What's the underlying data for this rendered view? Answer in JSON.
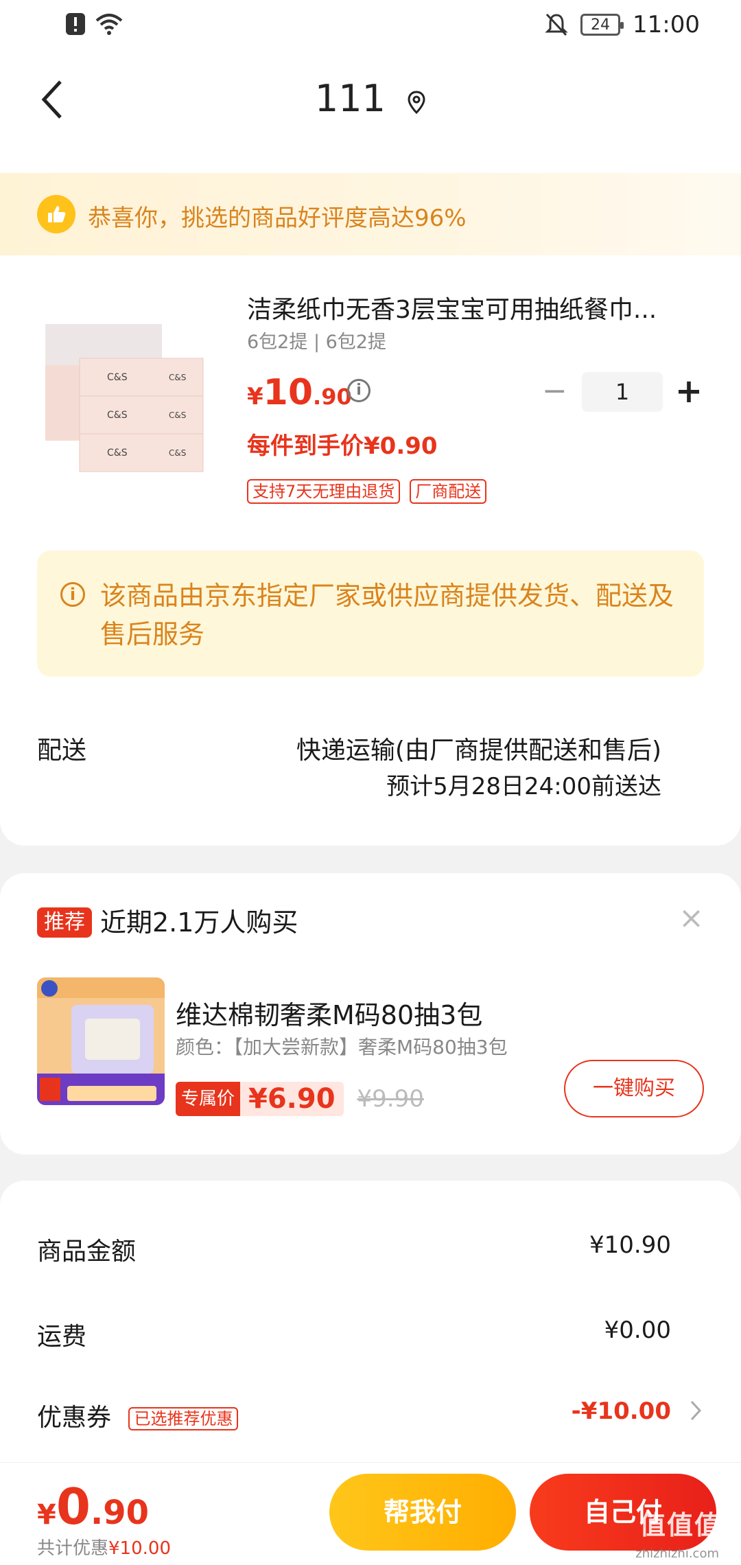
{
  "status_bar": {
    "time": "11:00",
    "battery": "24"
  },
  "header": {
    "title": "111"
  },
  "praise_banner": {
    "text": "恭喜你，挑选的商品好评度高达96%"
  },
  "product": {
    "title": "洁柔纸巾无香3层宝宝可用抽纸餐巾...",
    "spec": "6包2提 | 6包2提",
    "price_symbol": "¥",
    "price_int": "10",
    "price_dec": ".90",
    "quantity": "1",
    "unit_price": "每件到手价¥0.90",
    "tags": [
      "支持7天无理由退货",
      "厂商配送"
    ]
  },
  "notice": {
    "text": "该商品由京东指定厂家或供应商提供发货、配送及售后服务"
  },
  "shipping": {
    "label": "配送",
    "method": "快递运输(由厂商提供配送和售后)",
    "eta": "预计5月28日24:00前送达"
  },
  "recommend": {
    "badge": "推荐",
    "title": "近期2.1万人购买",
    "close": "×",
    "item_name": "维达棉韧奢柔M码80抽3包",
    "item_spec": "颜色：【加大尝新款】奢柔M码80抽3包",
    "price_label": "专属价",
    "price": "¥6.90",
    "old_price": "¥9.90",
    "buy_label": "一键购买"
  },
  "summary": {
    "goods_label": "商品金额",
    "goods_value": "¥10.90",
    "freight_label": "运费",
    "freight_value": "¥0.00",
    "coupon_label": "优惠券",
    "coupon_tag": "已选推荐优惠",
    "coupon_value": "-¥10.00"
  },
  "bottom": {
    "total_symbol": "¥",
    "total_int": "0",
    "total_dec": ".90",
    "saved_label": "共计优惠",
    "saved_value": "¥10.00",
    "help_pay": "帮我付",
    "self_pay": "自己付",
    "watermark": "值值值",
    "watermark_url": "zhizhizhi.com"
  },
  "colors": {
    "accent": "#e8341c",
    "gold": "#d9841e",
    "yellow": "#ffc21a"
  }
}
